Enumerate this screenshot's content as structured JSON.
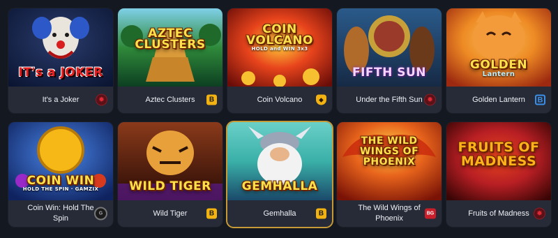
{
  "games": [
    {
      "name": "It's a Joker",
      "art_text": "IT's a JOKER",
      "art_sub": "",
      "provider_icon": "red-circle-logo",
      "provider_glyph": "✹",
      "colors": [
        "#2a3c6c",
        "#0b1533"
      ]
    },
    {
      "name": "Aztec Clusters",
      "art_text": "AZTEC CLUSTERS",
      "art_sub": "",
      "provider_icon": "booongo-b-logo",
      "provider_glyph": "B",
      "colors": [
        "#2f8a3a",
        "#0d3f22"
      ]
    },
    {
      "name": "Coin Volcano",
      "art_text": "COIN VOLCANO",
      "art_sub": "HOLD and WIN 3x3",
      "provider_icon": "shield-logo",
      "provider_glyph": "◆",
      "colors": [
        "#e8441c",
        "#6a0d08"
      ]
    },
    {
      "name": "Under the Fifth Sun",
      "art_text": "FIFTH SUN",
      "art_sub": "",
      "provider_icon": "red-circle-logo",
      "provider_glyph": "✹",
      "colors": [
        "#2a5a8a",
        "#162a45"
      ]
    },
    {
      "name": "Golden Lantern",
      "art_text": "GOLDEN",
      "art_sub": "Lantern",
      "provider_icon": "hexagon-logo",
      "provider_glyph": "B",
      "colors": [
        "#ee8a24",
        "#9d2a10"
      ]
    },
    {
      "name": "Coin Win: Hold The Spin",
      "art_text": "COIN WIN",
      "art_sub": "HOLD THE SPIN · GAMZIX",
      "provider_icon": "gamzix-logo",
      "provider_glyph": "G",
      "colors": [
        "#2a56b8",
        "#0f2360"
      ]
    },
    {
      "name": "Wild Tiger",
      "art_text": "WILD TIGER",
      "art_sub": "",
      "provider_icon": "booongo-b-logo",
      "provider_glyph": "B",
      "colors": [
        "#8a3a1a",
        "#2a0c06"
      ]
    },
    {
      "name": "Gemhalla",
      "art_text": "GEMHALLA",
      "art_sub": "",
      "provider_icon": "booongo-b-logo",
      "provider_glyph": "B",
      "colors": [
        "#3ab0a8",
        "#1a4a6a"
      ]
    },
    {
      "name": "The Wild Wings of Phoenix",
      "art_text": "THE WILD WINGS OF PHOENIX",
      "art_sub": "",
      "provider_icon": "bgaming-logo",
      "provider_glyph": "BG",
      "colors": [
        "#e8641c",
        "#7a1306"
      ]
    },
    {
      "name": "Fruits of Madness",
      "art_text": "FRUITS OF MADNESS",
      "art_sub": "",
      "provider_icon": "red-circle-logo",
      "provider_glyph": "✹",
      "colors": [
        "#b81f24",
        "#3a0505"
      ]
    }
  ]
}
